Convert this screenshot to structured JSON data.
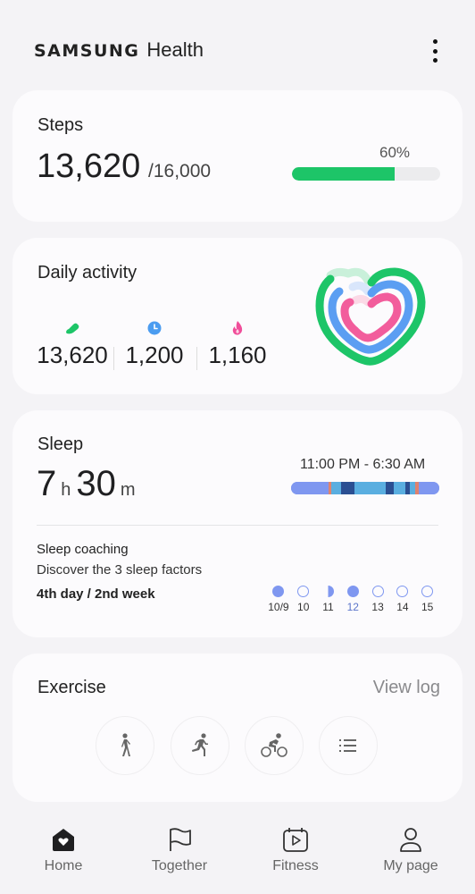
{
  "header": {
    "brand_samsung": "SAMSUNG",
    "brand_health": "Health",
    "more_icon": "more-vertical-icon"
  },
  "steps": {
    "title": "Steps",
    "value": "13,620",
    "goal": "/16,000",
    "percent_label": "60%",
    "bar_fill_fraction": 0.69,
    "bar_color": "#1dc568"
  },
  "activity": {
    "title": "Daily activity",
    "metrics": [
      {
        "icon": "shoe-icon",
        "value": "13,620",
        "color": "#1dc568"
      },
      {
        "icon": "clock-icon",
        "value": "1,200",
        "color": "#4b9cf0"
      },
      {
        "icon": "flame-icon",
        "value": "1,160",
        "color": "#f04e9a"
      }
    ],
    "rings": {
      "outer_color": "#1dc568",
      "middle_color": "#5b9ef2",
      "inner_color": "#f25d9c"
    }
  },
  "sleep": {
    "title": "Sleep",
    "hours": "7",
    "hours_unit": "h",
    "minutes": "30",
    "minutes_unit": "m",
    "range": "11:00 PM - 6:30 AM",
    "stages": [
      {
        "stage": "light",
        "start": 0.0,
        "end": 0.25,
        "color": "#7f97f0"
      },
      {
        "stage": "awake",
        "start": 0.25,
        "end": 0.27,
        "color": "#e0826e"
      },
      {
        "stage": "rem",
        "start": 0.27,
        "end": 0.34,
        "color": "#5aaee0"
      },
      {
        "stage": "deep",
        "start": 0.34,
        "end": 0.43,
        "color": "#2b4f92"
      },
      {
        "stage": "rem",
        "start": 0.43,
        "end": 0.64,
        "color": "#5aaee0"
      },
      {
        "stage": "deep",
        "start": 0.64,
        "end": 0.69,
        "color": "#2b4f92"
      },
      {
        "stage": "rem",
        "start": 0.69,
        "end": 0.77,
        "color": "#5aaee0"
      },
      {
        "stage": "deep",
        "start": 0.77,
        "end": 0.8,
        "color": "#2b4f92"
      },
      {
        "stage": "rem",
        "start": 0.8,
        "end": 0.84,
        "color": "#5aaee0"
      },
      {
        "stage": "awake",
        "start": 0.84,
        "end": 0.86,
        "color": "#e0826e"
      },
      {
        "stage": "light",
        "start": 0.86,
        "end": 1.0,
        "color": "#7f97f0"
      }
    ],
    "coaching_title": "Sleep coaching",
    "coaching_subtitle": "Discover the 3 sleep factors",
    "coaching_progress": "4th day / 2nd week",
    "days": [
      {
        "label": "10/9",
        "state": "full",
        "today": false
      },
      {
        "label": "10",
        "state": "empty",
        "today": false
      },
      {
        "label": "11",
        "state": "half",
        "today": false
      },
      {
        "label": "12",
        "state": "full",
        "today": true
      },
      {
        "label": "13",
        "state": "empty",
        "today": false
      },
      {
        "label": "14",
        "state": "empty",
        "today": false
      },
      {
        "label": "15",
        "state": "empty",
        "today": false
      }
    ]
  },
  "exercise": {
    "title": "Exercise",
    "view_log": "View log",
    "buttons": [
      {
        "icon": "walking-icon",
        "label": "Walking"
      },
      {
        "icon": "running-icon",
        "label": "Running"
      },
      {
        "icon": "cycling-icon",
        "label": "Cycling"
      },
      {
        "icon": "list-icon",
        "label": "More exercises"
      }
    ]
  },
  "nav": {
    "items": [
      {
        "icon": "home-heart-icon",
        "label": "Home",
        "active": true
      },
      {
        "icon": "flag-icon",
        "label": "Together",
        "active": false
      },
      {
        "icon": "calendar-play-icon",
        "label": "Fitness",
        "active": false
      },
      {
        "icon": "person-icon",
        "label": "My page",
        "active": false
      }
    ]
  }
}
